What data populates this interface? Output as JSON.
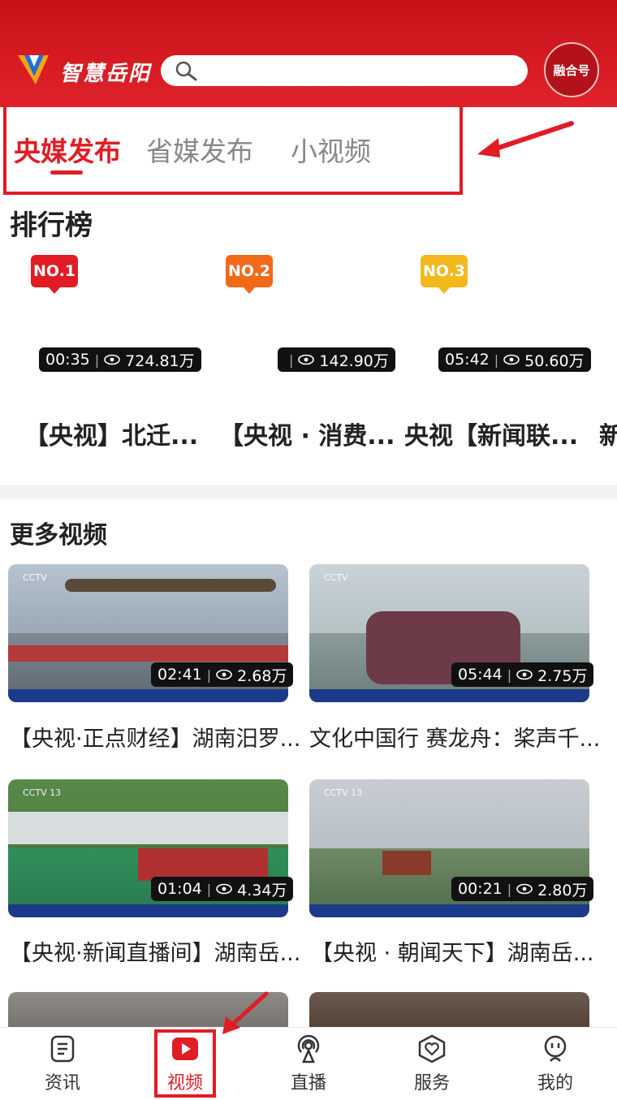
{
  "app": {
    "brand": "智慧岳阳",
    "badge": "融合号"
  },
  "search": {
    "placeholder": ""
  },
  "tabs": [
    {
      "label": "央媒发布",
      "active": true
    },
    {
      "label": "省媒发布",
      "active": false
    },
    {
      "label": "小视频",
      "active": false
    }
  ],
  "ranking": {
    "title": "排行榜",
    "items": [
      {
        "badge": "NO.1",
        "badge_color": "#e11c25",
        "duration": "00:35",
        "views": "724.81万",
        "title": "【央视】北迁..."
      },
      {
        "badge": "NO.2",
        "badge_color": "#f06a1a",
        "duration": "",
        "views": "142.90万",
        "title": "【央视 · 消费..."
      },
      {
        "badge": "NO.3",
        "badge_color": "#f2b81c",
        "duration": "05:42",
        "views": "50.60万",
        "title": "央视【新闻联..."
      }
    ]
  },
  "more": {
    "title": "更多视频",
    "videos": [
      {
        "duration": "02:41",
        "views": "2.68万",
        "title": "【央视·正点财经】湖南汨罗..."
      },
      {
        "duration": "05:44",
        "views": "2.75万",
        "title": "文化中国行 赛龙舟：桨声千..."
      },
      {
        "duration": "01:04",
        "views": "4.34万",
        "title": "【央视·新闻直播间】湖南岳..."
      },
      {
        "duration": "00:21",
        "views": "2.80万",
        "title": "【央视 · 朝闻天下】湖南岳..."
      }
    ]
  },
  "nav": [
    {
      "label": "资讯",
      "icon": "news-icon"
    },
    {
      "label": "视频",
      "icon": "video-icon",
      "active": true
    },
    {
      "label": "直播",
      "icon": "live-icon"
    },
    {
      "label": "服务",
      "icon": "service-icon"
    },
    {
      "label": "我的",
      "icon": "profile-icon"
    }
  ],
  "colors": {
    "accent": "#e11c25",
    "header": "#d0161e"
  }
}
